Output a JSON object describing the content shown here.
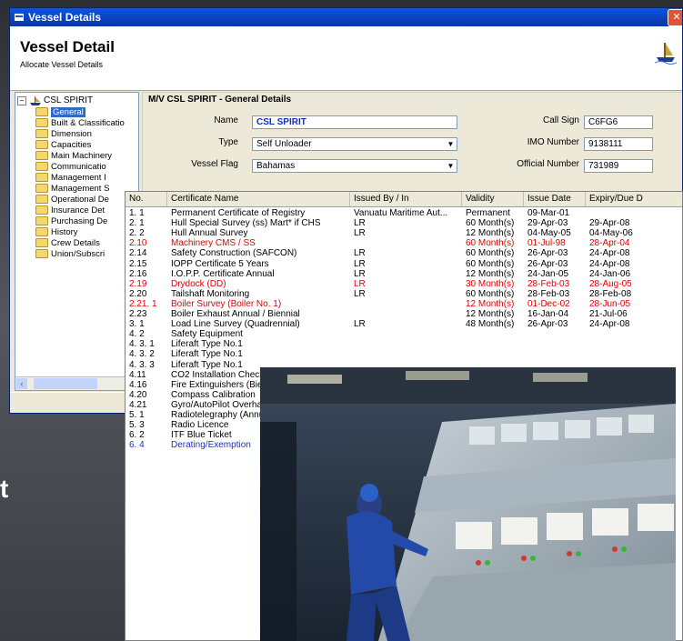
{
  "window": {
    "title": "Vessel Details",
    "close_glyph": "✕",
    "heading": "Vessel Detail",
    "subheading": "Allocate Vessel Details"
  },
  "tree": {
    "root": "CSL SPIRIT",
    "items": [
      "General",
      "Built & Classificatio",
      "Dimension",
      "Capacities",
      "Main Machinery",
      "Communicatio",
      "Management I",
      "Management S",
      "Operational De",
      "Insurance Det",
      "Purchasing De",
      "History",
      "Crew Details",
      "Union/Subscri"
    ],
    "selected_index": 0
  },
  "details": {
    "title": "M/V CSL SPIRIT - General Details",
    "name_label": "Name",
    "name_value": "CSL SPIRIT",
    "type_label": "Type",
    "type_value": "Self Unloader",
    "flag_label": "Vessel Flag",
    "flag_value": "Bahamas",
    "callsign_label": "Call Sign",
    "callsign_value": "C6FG6",
    "imo_label": "IMO Number",
    "imo_value": "9138111",
    "official_label": "Official Number",
    "official_value": "731989"
  },
  "table": {
    "columns": [
      "No.",
      "Certificate Name",
      "Issued By / In",
      "Validity",
      "Issue Date",
      "Expiry/Due D"
    ],
    "rows": [
      {
        "no": "1. 1",
        "name": "Permanent Certificate of Registry",
        "by": "Vanuatu  Maritime Aut...",
        "validity": "Permanent",
        "issue": "09-Mar-01",
        "expiry": "",
        "style": "normal"
      },
      {
        "no": "2. 1",
        "name": "Hull Special Survey (ss) Mart* if CHS",
        "by": "LR",
        "validity": "60 Month(s)",
        "issue": "29-Apr-03",
        "expiry": "29-Apr-08",
        "style": "normal"
      },
      {
        "no": "2. 2",
        "name": "Hull Annual Survey",
        "by": "LR",
        "validity": "12 Month(s)",
        "issue": "04-May-05",
        "expiry": "04-May-06",
        "style": "normal"
      },
      {
        "no": "2.10",
        "name": "Machinery CMS / SS",
        "by": "",
        "validity": "60 Month(s)",
        "issue": "01-Jul-98",
        "expiry": "28-Apr-04",
        "style": "red"
      },
      {
        "no": "2.14",
        "name": "Safety Construction (SAFCON)",
        "by": "LR",
        "validity": "60 Month(s)",
        "issue": "26-Apr-03",
        "expiry": "24-Apr-08",
        "style": "normal"
      },
      {
        "no": "2.15",
        "name": "IOPP Certificate 5 Years",
        "by": "LR",
        "validity": "60 Month(s)",
        "issue": "26-Apr-03",
        "expiry": "24-Apr-08",
        "style": "normal"
      },
      {
        "no": "2.16",
        "name": "I.O.P.P. Certificate Annual",
        "by": "LR",
        "validity": "12 Month(s)",
        "issue": "24-Jan-05",
        "expiry": "24-Jan-06",
        "style": "normal"
      },
      {
        "no": "2.19",
        "name": "Drydock (DD)",
        "by": "LR",
        "validity": "30 Month(s)",
        "issue": "28-Feb-03",
        "expiry": "28-Aug-05",
        "style": "red"
      },
      {
        "no": "2.20",
        "name": "Tailshaft Monitoring",
        "by": "LR",
        "validity": "60 Month(s)",
        "issue": "28-Feb-03",
        "expiry": "28-Feb-08",
        "style": "normal"
      },
      {
        "no": "2.21. 1",
        "name": "Boiler Survey (Boiler No. 1)",
        "by": "",
        "validity": "12 Month(s)",
        "issue": "01-Dec-02",
        "expiry": "28-Jun-05",
        "style": "red"
      },
      {
        "no": "2.23",
        "name": "Boiler Exhaust Annual / Biennial",
        "by": "",
        "validity": "12 Month(s)",
        "issue": "16-Jan-04",
        "expiry": "21-Jul-06",
        "style": "normal"
      },
      {
        "no": "3. 1",
        "name": "Load Line Survey (Quadrennial)",
        "by": "LR",
        "validity": "48 Month(s)",
        "issue": "26-Apr-03",
        "expiry": "24-Apr-08",
        "style": "normal"
      },
      {
        "no": "4. 2",
        "name": "Safety Equipment",
        "by": "",
        "validity": "",
        "issue": "",
        "expiry": "",
        "style": "normal"
      },
      {
        "no": "4. 3. 1",
        "name": "Liferaft Type  No.1",
        "by": "",
        "validity": "",
        "issue": "",
        "expiry": "",
        "style": "normal"
      },
      {
        "no": "4. 3. 2",
        "name": "Liferaft Type  No.1",
        "by": "",
        "validity": "",
        "issue": "",
        "expiry": "",
        "style": "normal"
      },
      {
        "no": "4. 3. 3",
        "name": "Liferaft Type  No.1",
        "by": "",
        "validity": "",
        "issue": "",
        "expiry": "",
        "style": "normal"
      },
      {
        "no": "4.11",
        "name": "CO2 Installation Check",
        "by": "",
        "validity": "",
        "issue": "",
        "expiry": "",
        "style": "normal"
      },
      {
        "no": "4.16",
        "name": "Fire Extinguishers (Bie",
        "by": "",
        "validity": "",
        "issue": "",
        "expiry": "",
        "style": "normal"
      },
      {
        "no": "4.20",
        "name": "Compass Calibration",
        "by": "",
        "validity": "",
        "issue": "",
        "expiry": "",
        "style": "normal"
      },
      {
        "no": "4.21",
        "name": "Gyro/AutoPilot Overha",
        "by": "",
        "validity": "",
        "issue": "",
        "expiry": "",
        "style": "normal"
      },
      {
        "no": "5. 1",
        "name": "Radiotelegraphy (Annu",
        "by": "",
        "validity": "",
        "issue": "",
        "expiry": "",
        "style": "normal"
      },
      {
        "no": "5. 3",
        "name": "Radio Licence",
        "by": "",
        "validity": "",
        "issue": "",
        "expiry": "",
        "style": "normal"
      },
      {
        "no": "6. 2",
        "name": "ITF Blue Ticket",
        "by": "",
        "validity": "",
        "issue": "",
        "expiry": "",
        "style": "normal"
      },
      {
        "no": "6. 4",
        "name": "Derating/Exemption",
        "by": "",
        "validity": "",
        "issue": "",
        "expiry": "",
        "style": "blue"
      }
    ]
  },
  "background_text": "t",
  "photo": {
    "subject": "ship engine control room"
  },
  "colors": {
    "accent": "#0a246a",
    "selection": "#316ac5",
    "overdue": "#e00000",
    "exemption": "#1c2ed8"
  }
}
